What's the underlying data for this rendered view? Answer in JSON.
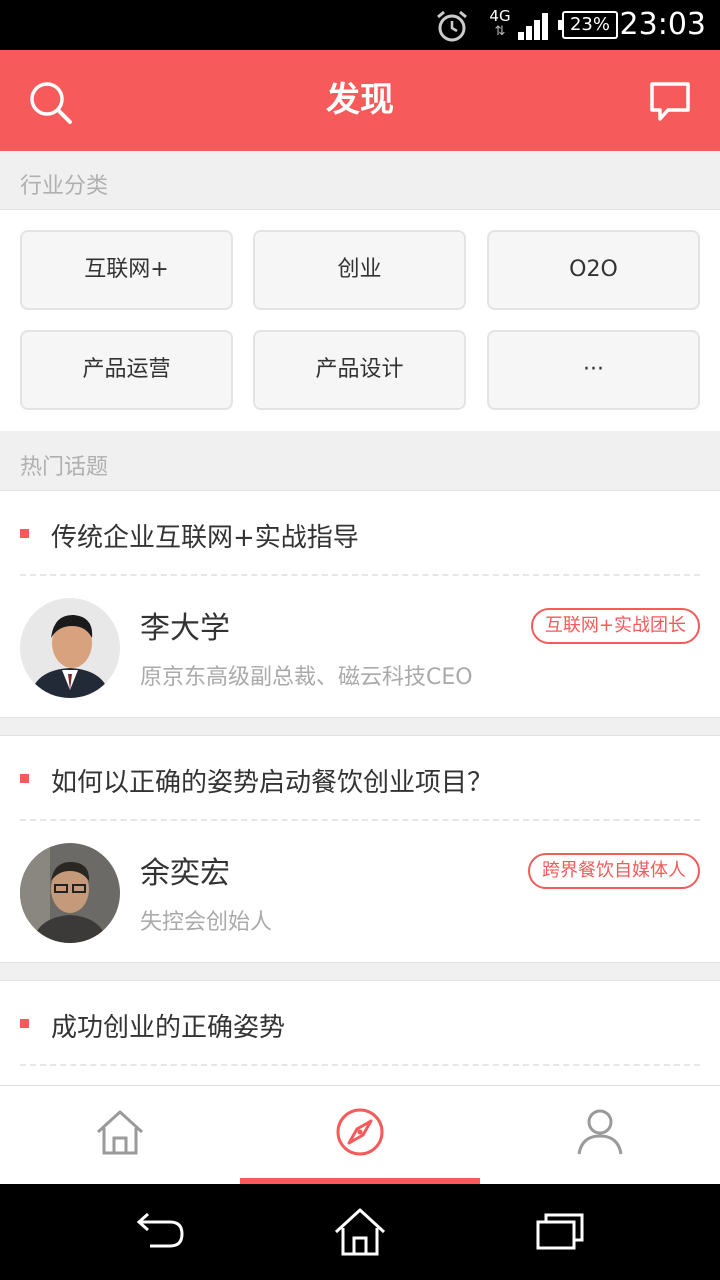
{
  "status_bar": {
    "network": "4G",
    "network_arrows": "⇅",
    "battery": "23%",
    "time": "23:03"
  },
  "header": {
    "title": "发现"
  },
  "industry_section": {
    "title": "行业分类",
    "categories": [
      "互联网+",
      "创业",
      "O2O",
      "产品运营",
      "产品设计",
      "···"
    ]
  },
  "hot_section": {
    "title": "热门话题"
  },
  "topics": [
    {
      "title": "传统企业互联网+实战指导",
      "name": "李大学",
      "desc": "原京东高级副总裁、磁云科技CEO",
      "badge": "互联网+实战团长"
    },
    {
      "title": "如何以正确的姿势启动餐饮创业项目？",
      "name": "余奕宏",
      "desc": "失控会创始人",
      "badge": "跨界餐饮自媒体人"
    },
    {
      "title": "成功创业的正确姿势"
    }
  ],
  "tabs": [
    {
      "icon": "home-icon"
    },
    {
      "icon": "compass-icon"
    },
    {
      "icon": "user-icon"
    }
  ],
  "colors": {
    "accent": "#f65a5a",
    "section_bg": "#f0f0f0"
  }
}
